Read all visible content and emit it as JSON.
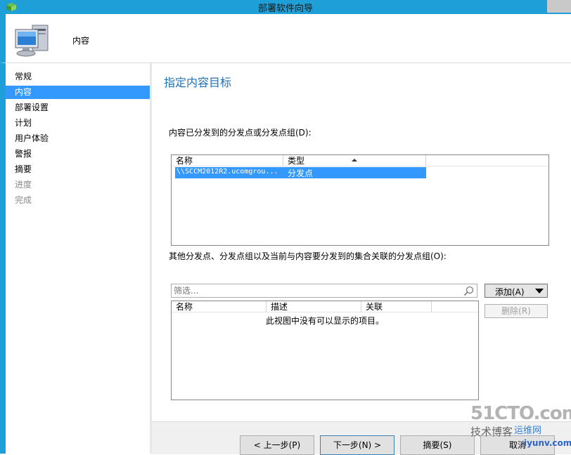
{
  "window": {
    "title": "部署软件向导"
  },
  "header": {
    "page_name": "内容",
    "icon": "computer-icon"
  },
  "nav": {
    "items": [
      {
        "label": "常规",
        "state": "normal"
      },
      {
        "label": "内容",
        "state": "active"
      },
      {
        "label": "部署设置",
        "state": "normal"
      },
      {
        "label": "计划",
        "state": "normal"
      },
      {
        "label": "用户体验",
        "state": "normal"
      },
      {
        "label": "警报",
        "state": "normal"
      },
      {
        "label": "摘要",
        "state": "normal"
      },
      {
        "label": "进度",
        "state": "disabled"
      },
      {
        "label": "完成",
        "state": "disabled"
      }
    ]
  },
  "main": {
    "title": "指定内容目标",
    "distributed_label": "内容已分发到的分发点或分发点组(D):",
    "distributed_list": {
      "columns": [
        "名称",
        "类型"
      ],
      "rows": [
        {
          "name": "\\\\SCCM2012R2.ucomgrou...",
          "type": "分发点"
        }
      ]
    },
    "other_label": "其他分发点、分发点组以及当前与内容要分发到的集合关联的分发点组(O):",
    "filter_placeholder": "筛选...",
    "add_button": "添加(A)",
    "delete_button": "删除(R)",
    "other_list": {
      "columns": [
        "名称",
        "描述",
        "关联"
      ],
      "empty_text": "此视图中没有可以显示的项目。"
    }
  },
  "footer": {
    "prev": "< 上一步(P)",
    "next": "下一步(N) >",
    "summary": "摘要(S)",
    "cancel": "取消"
  },
  "watermark": {
    "site": "51CTO.com",
    "tagline": "技术博客",
    "tagline2": "运维网",
    "url": "iyunv.com"
  },
  "colors": {
    "accent": "#1e9fd8",
    "selection": "#3399ff",
    "title_text": "#1f6fb5"
  }
}
